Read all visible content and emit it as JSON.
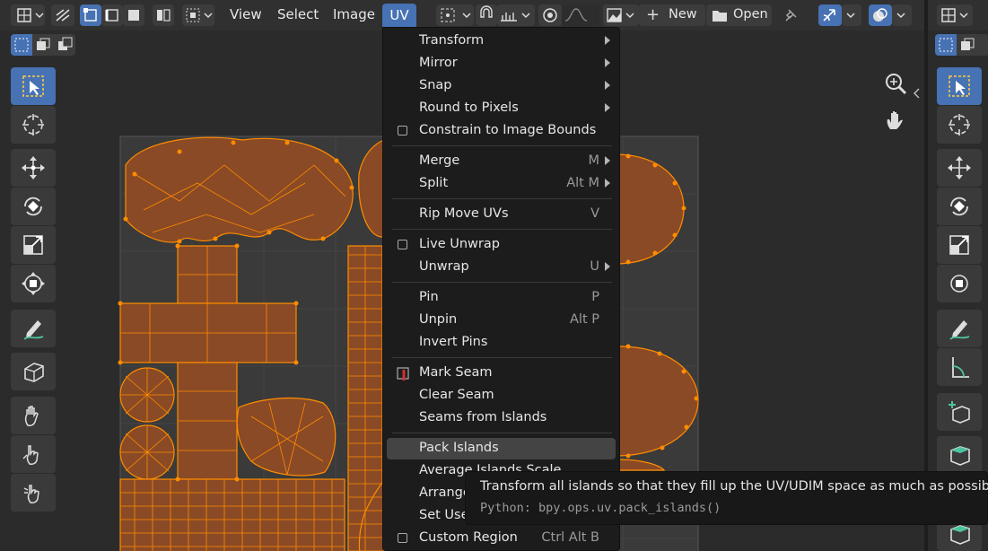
{
  "header": {
    "menus": [
      "View",
      "Select",
      "Image",
      "UV"
    ],
    "new_label": "New",
    "open_label": "Open"
  },
  "uv_menu": {
    "items": [
      {
        "label": "Transform",
        "shortcut": "",
        "submenu": true
      },
      {
        "label": "Mirror",
        "shortcut": "",
        "submenu": true
      },
      {
        "label": "Snap",
        "shortcut": "",
        "submenu": true
      },
      {
        "label": "Round to Pixels",
        "shortcut": "",
        "submenu": true
      },
      {
        "label": "Constrain to Image Bounds",
        "shortcut": "",
        "checkbox": true
      },
      {
        "label": "Merge",
        "shortcut": "M",
        "submenu": true
      },
      {
        "label": "Split",
        "shortcut": "Alt M",
        "submenu": true
      },
      {
        "label": "Rip Move UVs",
        "shortcut": "V"
      },
      {
        "label": "Live Unwrap",
        "shortcut": "",
        "checkbox": true
      },
      {
        "label": "Unwrap",
        "shortcut": "U",
        "submenu": true
      },
      {
        "label": "Pin",
        "shortcut": "P"
      },
      {
        "label": "Unpin",
        "shortcut": "Alt P"
      },
      {
        "label": "Invert Pins",
        "shortcut": ""
      },
      {
        "label": "Mark Seam",
        "shortcut": ""
      },
      {
        "label": "Clear Seam",
        "shortcut": ""
      },
      {
        "label": "Seams from Islands",
        "shortcut": ""
      },
      {
        "label": "Pack Islands",
        "shortcut": "",
        "highlighted": true
      },
      {
        "label": "Average Islands Scale",
        "shortcut": ""
      },
      {
        "label": "Arrange",
        "shortcut": ""
      },
      {
        "label": "Set Use",
        "shortcut": ""
      },
      {
        "label": "Custom Region",
        "shortcut": "Ctrl Alt B",
        "checkbox": true
      }
    ]
  },
  "tooltip": {
    "description": "Transform all islands so that they fill up the UV/UDIM space as much as possible.",
    "python": "Python: bpy.ops.uv.pack_islands()"
  },
  "colors": {
    "accent": "#4772b3",
    "island_fill": "#8a4a25",
    "island_edge": "#ff8c00"
  }
}
